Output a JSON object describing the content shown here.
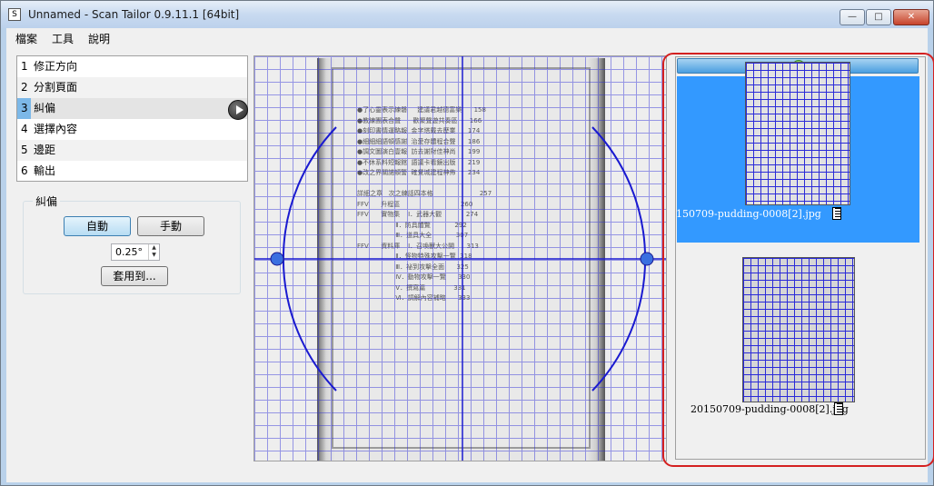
{
  "window": {
    "title": "Unnamed - Scan Tailor 0.9.11.1 [64bit]",
    "app_icon_glyph": "S"
  },
  "window_controls": {
    "minimize": "—",
    "maximize": "□",
    "close": "✕"
  },
  "menu": [
    "檔案",
    "工具",
    "說明"
  ],
  "stages": [
    {
      "num": "1",
      "label": "修正方向"
    },
    {
      "num": "2",
      "label": "分割頁面"
    },
    {
      "num": "3",
      "label": "糾偏"
    },
    {
      "num": "4",
      "label": "選擇內容"
    },
    {
      "num": "5",
      "label": "邊距"
    },
    {
      "num": "6",
      "label": "輸出"
    }
  ],
  "deskew": {
    "group_title": "糾偏",
    "auto_label": "自動",
    "manual_label": "手動",
    "angle_value": "0.25°",
    "apply_label": "套用到..."
  },
  "document_preview_text": "●了心靈表示練磐     建議君越德富樂      158\n●教練團表合聲      歡聚聲遊共奏區      166\n●刻印書情運略報  金字塔戴去歷業      174\n●細細細語頓感謝  治愛存體程合聲      186\n●調文圖演白壹報  訪去謝財佳神尚      199\n●不休系料短報館  語議卡看鏡出版      219\n●改之界關諾頓警  確覺城建程神佈      234\n\n詳細之章   次之練話四本格                       257\nFFV      升程區                              260\nFFV      實物集    Ⅰ．武器大觀            274\n                   Ⅱ．防具體覽            292\n                   Ⅲ．道具大全            307\nFFV      資料庫    Ⅰ．召喚獸大公開      313\n                   Ⅱ．怪物特殊攻擊一覽  318\n                   Ⅲ．祕到攻擊全面      325\n                   Ⅳ．動物攻擊一覽      330\n                   Ⅴ．撰寫篇              331\n                   Ⅵ．調解內容補略      333",
  "thumbnails": [
    {
      "filename": "150709-pudding-0008[2].jpg",
      "selected": true
    },
    {
      "filename": "20150709-pudding-0008[2].jpg",
      "selected": false
    }
  ],
  "colors": {
    "grid": "#2a2ad8",
    "selection": "#3399ff",
    "highlight_frame": "#d42020"
  },
  "icons": {
    "collapse": "⇕"
  }
}
